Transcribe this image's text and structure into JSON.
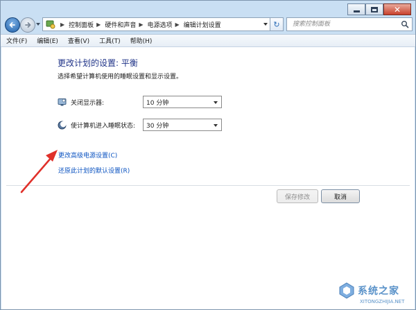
{
  "window": {
    "minimize_label": "–",
    "maximize_label": "□",
    "close_label": "✕"
  },
  "nav": {
    "breadcrumbs": [
      "控制面板",
      "硬件和声音",
      "电源选项",
      "编辑计划设置"
    ],
    "refresh_glyph": "↻",
    "search_placeholder": "搜索控制面板"
  },
  "menu": [
    "文件(F)",
    "编辑(E)",
    "查看(V)",
    "工具(T)",
    "帮助(H)"
  ],
  "page": {
    "title": "更改计划的设置: 平衡",
    "subtitle": "选择希望计算机使用的睡眠设置和显示设置。",
    "settings": [
      {
        "icon": "monitor-icon",
        "label": "关闭显示器:",
        "value": "10 分钟"
      },
      {
        "icon": "moon-icon",
        "label": "使计算机进入睡眠状态:",
        "value": "30 分钟"
      }
    ],
    "links": {
      "advanced": "更改高级电源设置(C)",
      "restore": "还原此计划的默认设置(R)"
    },
    "buttons": {
      "save": "保存修改",
      "cancel": "取消"
    }
  },
  "watermark": {
    "text": "系统之家",
    "url": "XITONGZHIJIA.NET"
  },
  "colors": {
    "title": "#1e3287",
    "link": "#0b53c1",
    "annotation_arrow": "#e0302a",
    "frame": "#c9dff3"
  }
}
